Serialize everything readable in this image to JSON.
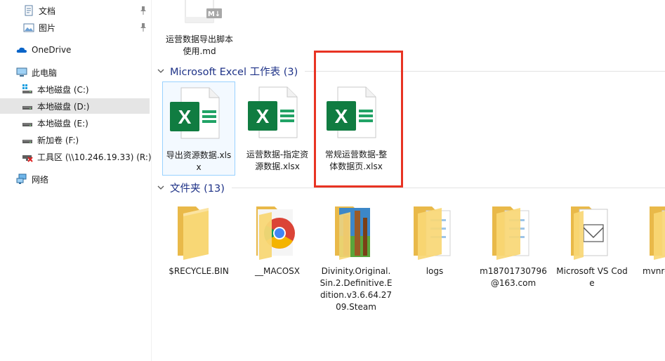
{
  "sidebar": {
    "items": [
      {
        "label": "文档",
        "icon": "documents-icon",
        "pinned": true
      },
      {
        "label": "图片",
        "icon": "pictures-icon",
        "pinned": true
      },
      {
        "label": "OneDrive",
        "icon": "onedrive-cloud-icon"
      },
      {
        "label": "此电脑",
        "icon": "this-pc-icon"
      },
      {
        "label": "本地磁盘 (C:)",
        "icon": "windows-drive-icon"
      },
      {
        "label": "本地磁盘 (D:)",
        "icon": "drive-icon",
        "selected": true
      },
      {
        "label": "本地磁盘 (E:)",
        "icon": "drive-icon"
      },
      {
        "label": "新加卷 (F:)",
        "icon": "drive-icon"
      },
      {
        "label": "工具区 (\\\\10.246.19.33) (R:)",
        "icon": "network-drive-disconnected-icon"
      },
      {
        "label": "网络",
        "icon": "network-icon"
      }
    ]
  },
  "content": {
    "top_file": {
      "name": "运营数据导出脚本使用.md",
      "icon": "markdown-file-icon",
      "badge": "M↓"
    },
    "groups": [
      {
        "title": "Microsoft Excel 工作表 (3)",
        "items": [
          {
            "name": "导出资源数据.xlsx",
            "icon": "excel-file-icon",
            "selected": true
          },
          {
            "name": "运营数据-指定资源数据.xlsx",
            "icon": "excel-file-icon"
          },
          {
            "name": "常规运营数据-整体数据页.xlsx",
            "icon": "excel-file-icon"
          }
        ]
      },
      {
        "title": "文件夹 (13)",
        "items": [
          {
            "name": "$RECYCLE.BIN",
            "icon": "folder-icon"
          },
          {
            "name": "__MACOSX",
            "icon": "folder-chrome-icon"
          },
          {
            "name": "Divinity.Original.Sin.2.Definitive.Edition.v3.6.64.2709.Steam",
            "icon": "folder-winrar-icon"
          },
          {
            "name": "logs",
            "icon": "folder-documents-icon"
          },
          {
            "name": "m18701730796@163.com",
            "icon": "folder-documents-icon"
          },
          {
            "name": "Microsoft VS Code",
            "icon": "folder-vscode-icon"
          },
          {
            "name": "mvnre",
            "icon": "folder-documents-icon"
          }
        ]
      }
    ]
  },
  "colors": {
    "group_title": "#1e3287",
    "excel_green": "#107c41",
    "folder_yellow": "#f8d775",
    "highlight_red": "#e83323",
    "selection": "#99d1ff"
  }
}
